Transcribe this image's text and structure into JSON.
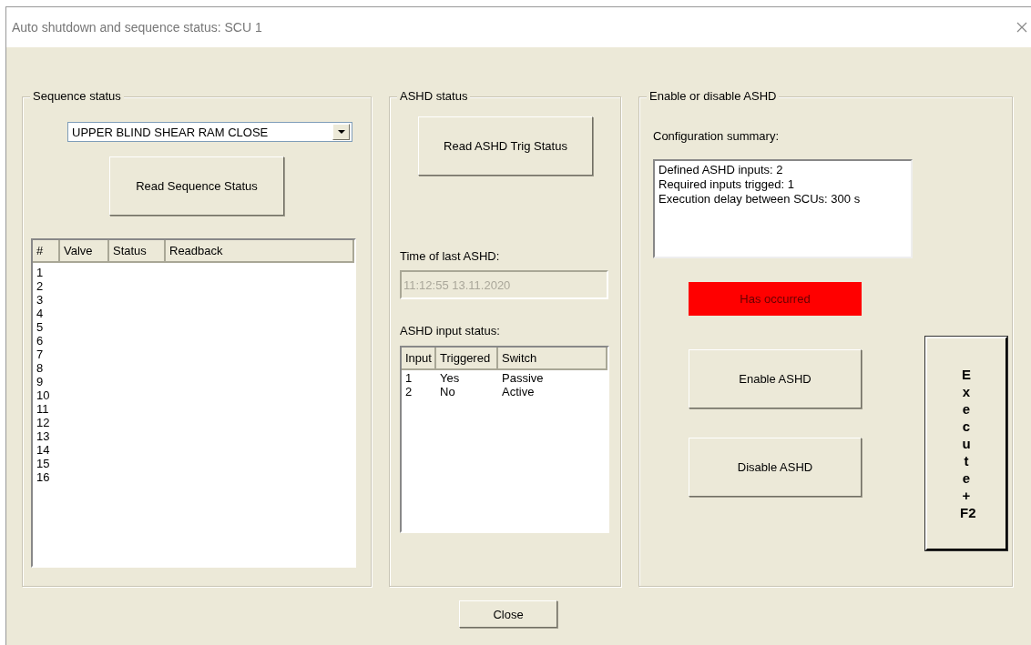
{
  "window": {
    "title": "Auto shutdown and sequence status: SCU 1"
  },
  "sequence_status": {
    "title": "Sequence status",
    "sequence_select": {
      "value": "UPPER BLIND SHEAR RAM CLOSE"
    },
    "read_button": "Read Sequence Status",
    "table": {
      "columns": [
        "#",
        "Valve",
        "Status",
        "Readback"
      ],
      "rows": [
        [
          "1"
        ],
        [
          "2"
        ],
        [
          "3"
        ],
        [
          "4"
        ],
        [
          "5"
        ],
        [
          "6"
        ],
        [
          "7"
        ],
        [
          "8"
        ],
        [
          "9"
        ],
        [
          "10"
        ],
        [
          "11"
        ],
        [
          "12"
        ],
        [
          "13"
        ],
        [
          "14"
        ],
        [
          "15"
        ],
        [
          "16"
        ]
      ]
    }
  },
  "ashd_status": {
    "title": "ASHD status",
    "read_button": "Read ASHD Trig Status",
    "time_label": "Time of last ASHD:",
    "time_field": {
      "value": "11:12:55 13.11.2020",
      "disabled": true
    },
    "input_label": "ASHD input status:",
    "table": {
      "columns": [
        "Input",
        "Triggered",
        "Switch"
      ],
      "rows": [
        [
          "1",
          "Yes",
          "Passive"
        ],
        [
          "2",
          "No",
          "Active"
        ]
      ]
    }
  },
  "enable_disable": {
    "title": "Enable or disable ASHD",
    "summary_label": "Configuration summary:",
    "summary_lines": [
      "Defined ASHD inputs: 2",
      "Required inputs trigged: 1",
      "Execution delay between SCUs: 300 s"
    ],
    "status_indicator": {
      "text": "Has occurred",
      "color": "#ff0000"
    },
    "buttons": [
      "Enable ASHD",
      "Disable ASHD"
    ],
    "execute_button": "E x e c u t e + F2"
  },
  "close_button": "Close"
}
